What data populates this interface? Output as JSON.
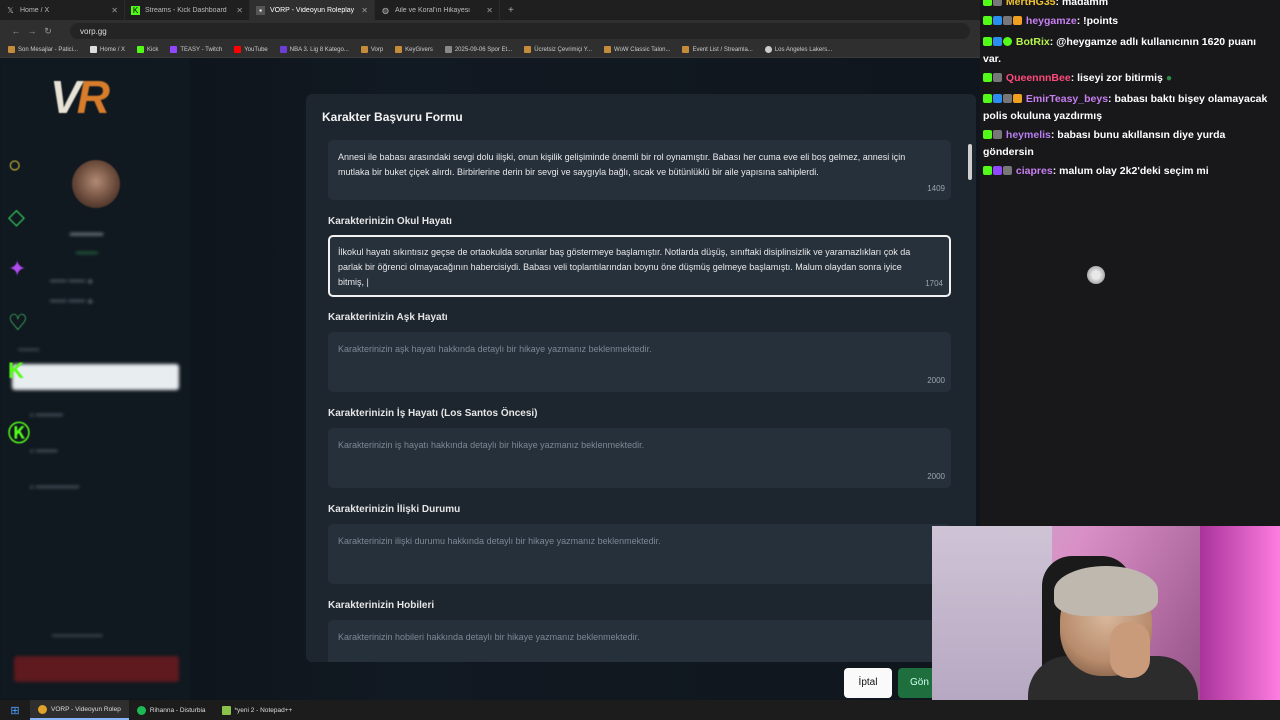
{
  "browser": {
    "tabs": [
      {
        "title": "Home / X",
        "icon": "x-icon",
        "active": false
      },
      {
        "title": "Streams - Kick Dashboard",
        "icon": "kick-icon",
        "active": false
      },
      {
        "title": "VORP - Videoyun Roleplay",
        "icon": "vorp-icon",
        "active": true
      },
      {
        "title": "Aile ve Koral'ın Hikayesi",
        "icon": "globe-icon",
        "active": false
      }
    ],
    "url": "vorp.gg",
    "bookmarks": [
      "Son Mesajlar - Patici...",
      "Home / X",
      "Kick",
      "TEASY - Twitch",
      "YouTube",
      "NBA 3. Lig 8 Katego...",
      "Vorp",
      "KeyGivers",
      "2025-09-06 Spor Et...",
      "Ücretsiz Çevrimiçi Y...",
      "WoW Classic Talon...",
      "Event List / Streamla...",
      "Los Angeles Lakers..."
    ]
  },
  "modal": {
    "title": "Karakter Başvuru Formu",
    "fields": [
      {
        "label": "",
        "value": "Annesi ile babası arasındaki sevgi dolu ilişki, onun kişilik gelişiminde önemli bir rol oynamıştır. Babası her cuma eve eli boş gelmez, annesi için mutlaka bir buket çiçek alırdı. Birbirlerine derin bir sevgi ve saygıyla bağlı, sıcak ve bütünlüklü bir aile yapısına sahiplerdi.",
        "placeholder": "",
        "counter": "1409"
      },
      {
        "label": "Karakterinizin Okul Hayatı",
        "value": "İlkokul hayatı sıkıntısız geçse de ortaokulda sorunlar baş göstermeye başlamıştır. Notlarda düşüş, sınıftaki disiplinsizlik ve yaramazlıkları çok da parlak bir öğrenci olmayacağının habercisiydi. Babası veli toplantılarından boynu öne düşmüş gelmeye başlamıştı. Malum olaydan sonra iyice bitmiş, |",
        "placeholder": "",
        "counter": "1704"
      },
      {
        "label": "Karakterinizin Aşk Hayatı",
        "value": "",
        "placeholder": "Karakterinizin aşk hayatı hakkında detaylı bir hikaye yazmanız beklenmektedir.",
        "counter": "2000"
      },
      {
        "label": "Karakterinizin İş Hayatı (Los Santos Öncesi)",
        "value": "",
        "placeholder": "Karakterinizin iş hayatı hakkında detaylı bir hikaye yazmanız beklenmektedir.",
        "counter": "2000"
      },
      {
        "label": "Karakterinizin İlişki Durumu",
        "value": "",
        "placeholder": "Karakterinizin ilişki durumu hakkında detaylı bir hikaye yazmanız beklenmektedir.",
        "counter": "1("
      },
      {
        "label": "Karakterinizin Hobileri",
        "value": "",
        "placeholder": "Karakterinizin hobileri hakkında detaylı bir hikaye yazmanız beklenmektedir.",
        "counter": ""
      }
    ],
    "cancel_label": "İptal",
    "submit_label": "Gön"
  },
  "chat": {
    "messages": [
      {
        "user": "MertHG35",
        "color": "#f0c230",
        "text": ": madamm"
      },
      {
        "user": "heygamze",
        "color": "#c87ff0",
        "text": ": !points"
      },
      {
        "user": "BotRix",
        "color": "#b6f34a",
        "text": ": @heygamze adlı kullanıcının 1620 puanı var."
      },
      {
        "user": "QueennnBee",
        "color": "#ff4a7a",
        "text": ": liseyi zor bitirmiş"
      },
      {
        "user": "EmirTeasy_beys",
        "color": "#c87ff0",
        "text": ": babası baktı bişey olamayacak polis okuluna yazdırmış"
      },
      {
        "user": "heymelis",
        "color": "#b77df0",
        "text": ": babası bunu akıllansın diye yurda göndersin"
      },
      {
        "user": "ciapres",
        "color": "#c87ff0",
        "text": ": malum olay 2k2'deki seçim mi"
      }
    ]
  },
  "taskbar": {
    "items": [
      {
        "label": "VORP - Videoyun Rolep",
        "active": true
      },
      {
        "label": "Rihanna - Disturbia",
        "active": false
      },
      {
        "label": "*yeni 2 - Notepad++",
        "active": false
      }
    ]
  },
  "colors": {
    "modal_bg": "#1d252e",
    "field_bg": "#26303b",
    "accent_green": "#1f6f3e",
    "kick_green": "#53fc18"
  }
}
